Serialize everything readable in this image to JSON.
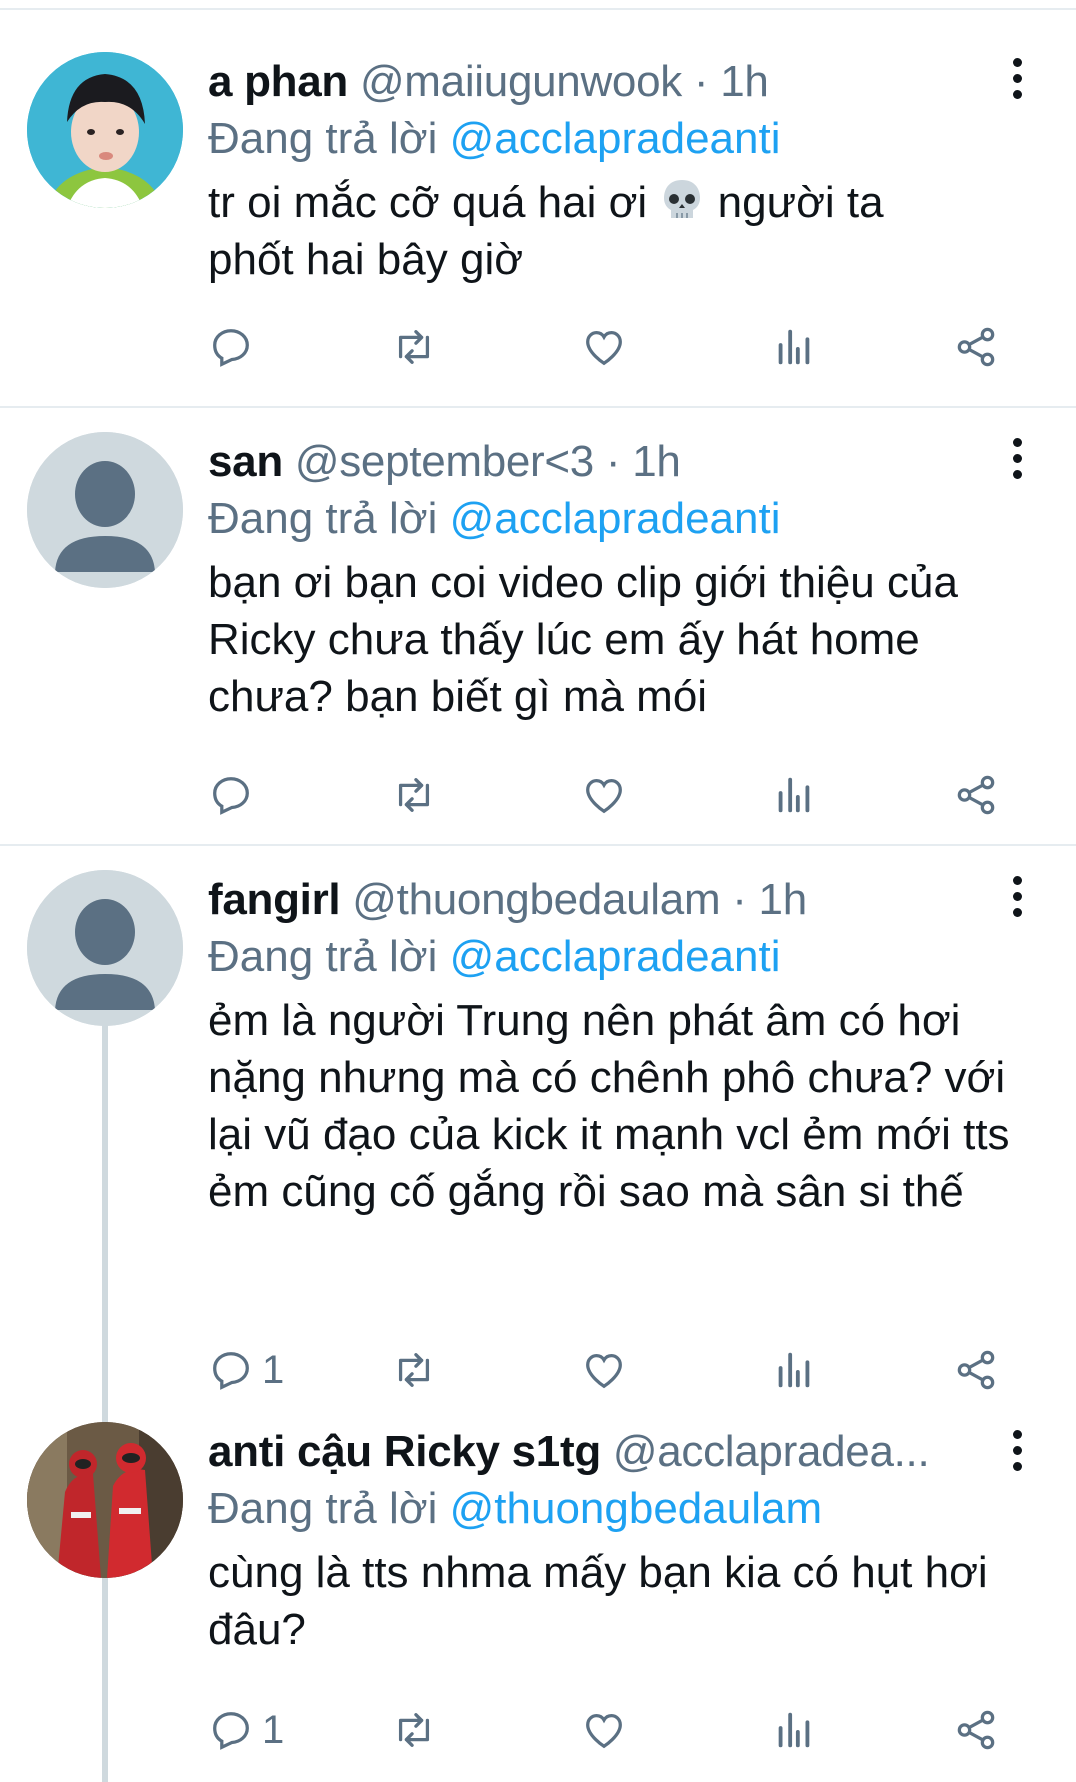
{
  "tweets": [
    {
      "display_name": "a phan",
      "handle": "@maiiugunwook",
      "dot": "·",
      "time": "1h",
      "reply_prefix": "Đang trả lời",
      "reply_to": "@acclapradeanti",
      "text_before_emoji": "tr oi mắc cỡ quá hai ơi ",
      "emoji": "skull-emoji",
      "text_after_emoji": " người ta phốt hai bây giờ",
      "reply_count": "",
      "avatar": "photo-avatar"
    },
    {
      "display_name": "san",
      "handle": "@september<3",
      "dot": "·",
      "time": "1h",
      "reply_prefix": "Đang trả lời",
      "reply_to": "@acclapradeanti",
      "text": "bạn ơi bạn coi video clip giới thiệu của Ricky chưa thấy lúc em ấy hát home chưa? bạn biết gì mà mói",
      "reply_count": "",
      "avatar": "default-avatar"
    },
    {
      "display_name": "fangirl",
      "handle": "@thuongbedaulam",
      "dot": "·",
      "time": "1h",
      "reply_prefix": "Đang trả lời",
      "reply_to": "@acclapradeanti",
      "text": "ẻm là người Trung nên phát âm có hơi nặng nhưng mà có chênh phô chưa? với lại vũ đạo của kick it mạnh vcl ẻm mới tts ẻm cũng cố gắng rồi sao mà sân si thế",
      "reply_count": "1",
      "avatar": "default-avatar"
    },
    {
      "display_name": "anti cậu Ricky s1tg",
      "handle": "@acclapradea...",
      "dot": "",
      "time": "",
      "reply_prefix": "Đang trả lời",
      "reply_to": "@thuongbedaulam",
      "text": "cùng là tts nhma mấy bạn kia có hụt hơi đâu?",
      "reply_count": "1",
      "avatar": "photo-avatar-red"
    }
  ],
  "icons": {
    "reply": "reply-icon",
    "retweet": "retweet-icon",
    "like": "heart-icon",
    "analytics": "analytics-icon",
    "share": "share-icon",
    "more": "more-options-icon"
  },
  "colors": {
    "text": "#0f1419",
    "secondary": "#5b7083",
    "link": "#1da1f2",
    "divider": "#e6ecf0"
  }
}
